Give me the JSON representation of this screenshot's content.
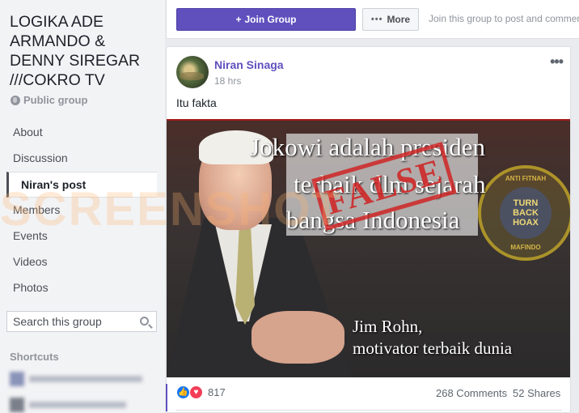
{
  "group": {
    "title": "LOGIKA ADE ARMANDO & DENNY SIREGAR ///COKRO TV",
    "privacy": "Public group"
  },
  "nav": {
    "items": [
      {
        "label": "About"
      },
      {
        "label": "Discussion"
      },
      {
        "label": "Niran's post",
        "active": true
      },
      {
        "label": "Members"
      },
      {
        "label": "Events"
      },
      {
        "label": "Videos"
      },
      {
        "label": "Photos"
      }
    ]
  },
  "search": {
    "placeholder": "Search this group"
  },
  "shortcuts": {
    "label": "Shortcuts"
  },
  "toolbar": {
    "join_label": "Join Group",
    "more_label": "More",
    "join_hint": "Join this group to post and commen"
  },
  "post": {
    "author": "Niran Sinaga",
    "timestamp": "18 hrs",
    "text": "Itu fakta",
    "image": {
      "line1": "Jokowi adalah presiden",
      "line2": "terbaik dlm sejarah",
      "line3": "bangsa Indonesia",
      "stamp": "FALSE",
      "caption1": "Jim Rohn,",
      "caption2": "motivator terbaik dunia",
      "badge_text": "TURN BACK HOAX",
      "badge_ring_top": "ANTI FITNAH",
      "badge_ring_bottom": "MAFINDO"
    },
    "reactions_count": "817",
    "comments": "268 Comments",
    "shares": "52 Shares"
  },
  "watermark": "SCREENSHOT",
  "colors": {
    "accent": "#5f50be",
    "sidebar_bg": "#f2f3f5",
    "like": "#1877f2",
    "love": "#f33e58",
    "stamp": "#d02020"
  }
}
